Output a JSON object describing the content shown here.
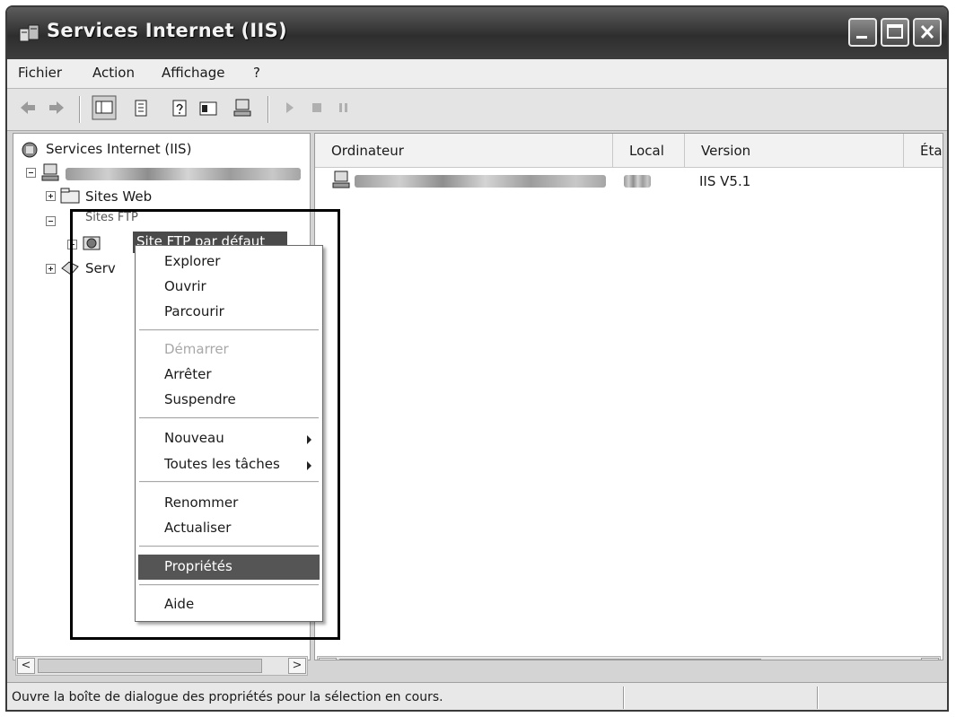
{
  "window": {
    "title": "Services Internet (IIS)"
  },
  "menu": [
    "Fichier",
    "Action",
    "Affichage",
    "?"
  ],
  "tree": {
    "root": "Services Internet (IIS)",
    "web_sites": "Sites Web",
    "ftp_sites": "Sites FTP",
    "ftp_default": "Site FTP par défaut",
    "services_partial": "Serv"
  },
  "list": {
    "columns": [
      "Ordinateur",
      "Local",
      "Version",
      "Éta"
    ],
    "rows": [
      {
        "version": "IIS V5.1"
      }
    ]
  },
  "context_menu": {
    "items": [
      {
        "label": "Explorer"
      },
      {
        "label": "Ouvrir"
      },
      {
        "label": "Parcourir"
      },
      {
        "label": "Démarrer",
        "disabled": true
      },
      {
        "label": "Arrêter"
      },
      {
        "label": "Suspendre"
      },
      {
        "label": "Nouveau",
        "submenu": true
      },
      {
        "label": "Toutes les tâches",
        "submenu": true
      },
      {
        "label": "Renommer"
      },
      {
        "label": "Actualiser"
      },
      {
        "label": "Propriétés",
        "selected": true
      },
      {
        "label": "Aide"
      }
    ]
  },
  "status": {
    "text": "Ouvre la boîte de dialogue des propriétés pour la sélection en cours."
  },
  "colors": {
    "title_bar": "#3d3d3d",
    "selection": "#555555"
  }
}
